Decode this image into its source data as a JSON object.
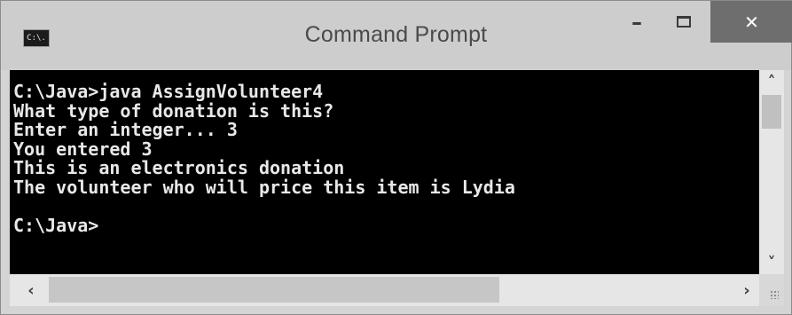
{
  "window": {
    "title": "Command Prompt",
    "icon_label": "C:\\.",
    "min_glyph": "–",
    "close_glyph": "✕"
  },
  "console": {
    "lines": [
      "C:\\Java>java AssignVolunteer4",
      "What type of donation is this?",
      "Enter an integer... 3",
      "You entered 3",
      "This is an electronics donation",
      "The volunteer who will price this item is Lydia",
      "",
      "C:\\Java>"
    ]
  },
  "scrollbars": {
    "up_glyph": "˄",
    "down_glyph": "˅",
    "left_glyph": "‹",
    "right_glyph": "›"
  },
  "icons": {
    "app": "console-icon",
    "minimize": "minimize-icon",
    "maximize": "maximize-icon",
    "close": "close-icon",
    "resize": "resize-grip-icon"
  },
  "colors": {
    "console_bg": "#000000",
    "console_fg": "#e8e8e8",
    "close_bg": "#6e6e6e",
    "titlebar_bg": "#cdcdcd"
  }
}
